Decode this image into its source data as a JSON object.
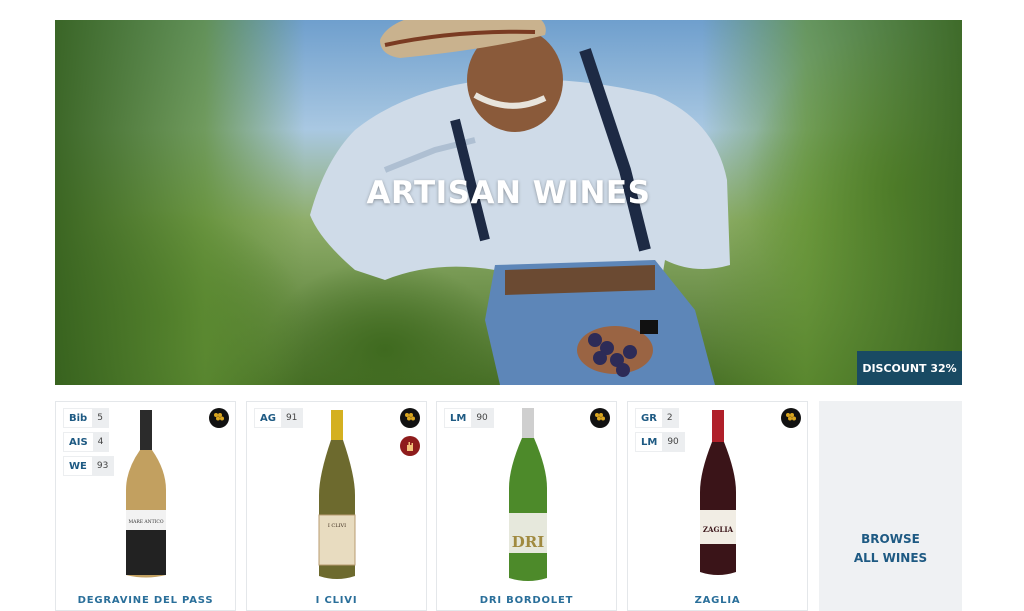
{
  "hero": {
    "title": "ARTISAN WINES",
    "discount_label": "DISCOUNT 32%"
  },
  "products": [
    {
      "ratings": [
        {
          "code": "Bib",
          "score": "5"
        },
        {
          "code": "AIS",
          "score": "4"
        },
        {
          "code": "WE",
          "score": "93"
        }
      ],
      "awards": [
        "grapes-award-icon"
      ],
      "bottle_label": "MARE ANTICO",
      "name": "DEGRAVINE DEL PASS"
    },
    {
      "ratings": [
        {
          "code": "AG",
          "score": "91"
        }
      ],
      "awards": [
        "grapes-award-icon",
        "hand-award-icon"
      ],
      "bottle_label": "I CLIVI",
      "name": "I CLIVI"
    },
    {
      "ratings": [
        {
          "code": "LM",
          "score": "90"
        }
      ],
      "awards": [
        "grapes-award-icon"
      ],
      "bottle_label": "DRI",
      "name": "DRI BORDOLET"
    },
    {
      "ratings": [
        {
          "code": "GR",
          "score": "2"
        },
        {
          "code": "LM",
          "score": "90"
        }
      ],
      "awards": [
        "grapes-award-icon"
      ],
      "bottle_label": "ZAGLIA",
      "name": "ZAGLIA"
    }
  ],
  "browse": {
    "line1": "BROWSE",
    "line2": "ALL WINES"
  },
  "colors": {
    "accent_blue": "#1e5a83",
    "badge_navy": "#194a63",
    "award_black": "#111111",
    "award_red": "#8e1c1c"
  }
}
